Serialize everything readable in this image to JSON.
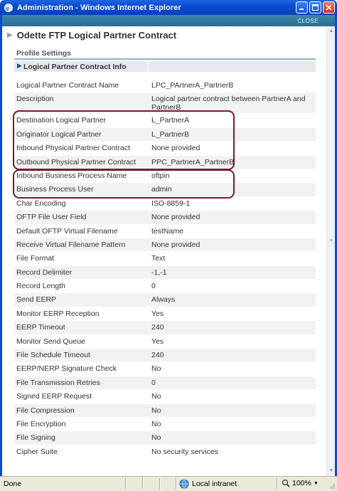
{
  "window": {
    "title": "Administration - Windows Internet Explorer",
    "close_link": "CLOSE"
  },
  "page": {
    "title": "Odette FTP Logical Partner Contract",
    "section": "Profile Settings",
    "subsection": "Logical Partner Contract Info"
  },
  "rows": [
    {
      "label": "Logical Partner Contract Name",
      "value": "LPC_PArtnerA_PartnerB"
    },
    {
      "label": "Description",
      "value": "Logical partner contract between PartnerA and PartnerB"
    },
    {
      "label": "Destination Logical Partner",
      "value": "L_PartnerA"
    },
    {
      "label": "Originator Logical Partner",
      "value": "L_PartnerB"
    },
    {
      "label": "Inbound Physical Partner Contract",
      "value": "None provided"
    },
    {
      "label": "Outbound Physical Partner Contract",
      "value": "PPC_PartnerA_PartnerB"
    },
    {
      "label": "Inbound Business Process Name",
      "value": "oftpin"
    },
    {
      "label": "Business Process User",
      "value": "admin"
    },
    {
      "label": "Char Encoding",
      "value": "ISO-8859-1"
    },
    {
      "label": "OFTP File User Field",
      "value": "None provided"
    },
    {
      "label": "Default OFTP Virtual Filename",
      "value": "testName"
    },
    {
      "label": "Receive Virtual Filename Pattern",
      "value": "None provided"
    },
    {
      "label": "File Format",
      "value": "Text"
    },
    {
      "label": "Record Delimiter",
      "value": "-1,-1"
    },
    {
      "label": "Record Length",
      "value": "0"
    },
    {
      "label": "Send EERP",
      "value": "Always"
    },
    {
      "label": "Monitor EERP Reception",
      "value": "Yes"
    },
    {
      "label": "EERP Timeout",
      "value": "240"
    },
    {
      "label": "Monitor Send Queue",
      "value": "Yes"
    },
    {
      "label": "File Schedule Timeout",
      "value": "240"
    },
    {
      "label": "EERP/NERP Signature Check",
      "value": "No"
    },
    {
      "label": "File Transmission Retries",
      "value": "0"
    },
    {
      "label": "Signed EERP Request",
      "value": "No"
    },
    {
      "label": "File Compression",
      "value": "No"
    },
    {
      "label": "File Encryption",
      "value": "No"
    },
    {
      "label": "File Signing",
      "value": "No"
    },
    {
      "label": "Cipher Suite",
      "value": "No security services"
    }
  ],
  "statusbar": {
    "status": "Done",
    "zone": "Local intranet",
    "zoom": "100%"
  },
  "colors": {
    "titlebar": "#0a4bd0",
    "header_strip": "#2c6e92",
    "highlight_border": "#7a1a2a",
    "row_alt": "#f2f2f2"
  },
  "icons": [
    "ie-icon",
    "minimize-icon",
    "maximize-icon",
    "close-icon",
    "globe-icon",
    "zoom-icon"
  ]
}
